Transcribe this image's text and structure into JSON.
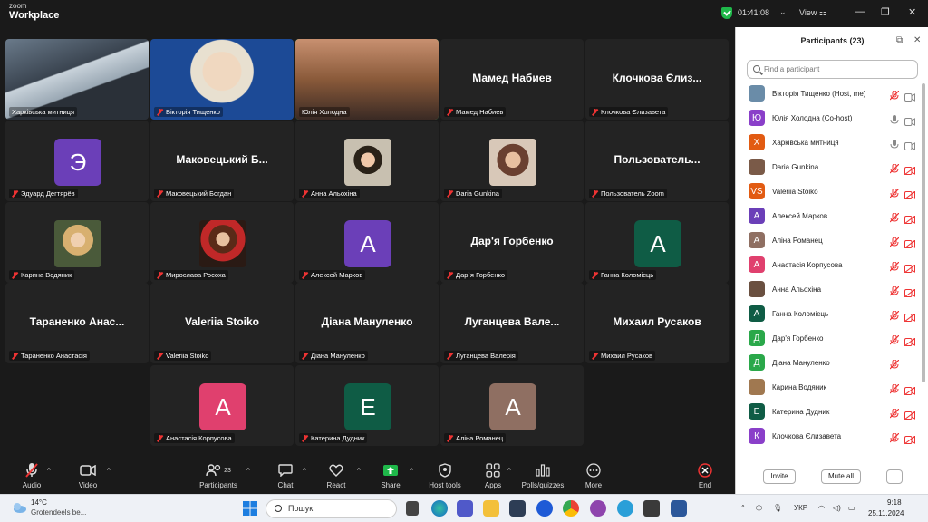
{
  "app": {
    "brand_line1": "zoom",
    "brand_line2": "Workplace",
    "timer": "01:41:08",
    "view_label": "View"
  },
  "tiles": [
    {
      "label": "Харківська митниця",
      "kind": "video",
      "muted": false
    },
    {
      "label": "Вікторія Тищенко",
      "kind": "video",
      "muted": true
    },
    {
      "label": "Юлія Холодна",
      "kind": "video",
      "muted": false,
      "active": true
    },
    {
      "name": "Мамед Набиев",
      "label": "Мамед Набиев",
      "kind": "name",
      "muted": true
    },
    {
      "name": "Клочкова Єлиз...",
      "label": "Клочкова Єлизавета",
      "kind": "name",
      "muted": true
    },
    {
      "avatar": "Э",
      "color": "#6b3fb8",
      "label": "Эдуард Дегтярёв",
      "kind": "avatar",
      "muted": true
    },
    {
      "name": "Маковецький Б...",
      "label": "Маковецький Богдан",
      "kind": "name",
      "muted": true
    },
    {
      "label": "Анна Альохіна",
      "kind": "photo",
      "muted": true
    },
    {
      "label": "Daria Gunkina",
      "kind": "photo",
      "muted": true
    },
    {
      "name": "Пользователь...",
      "label": "Пользователь Zoom",
      "kind": "name",
      "muted": true
    },
    {
      "label": "Карина Водяник",
      "kind": "photo",
      "muted": true
    },
    {
      "label": "Мирослава Росоха",
      "kind": "photo",
      "muted": true
    },
    {
      "avatar": "A",
      "color": "#6b3fb8",
      "label": "Алексей Марков",
      "kind": "avatar",
      "muted": true
    },
    {
      "name": "Дар'я Горбенко",
      "label": "Дар`я Горбенко",
      "kind": "name",
      "muted": true
    },
    {
      "avatar": "A",
      "color": "#0f5c45",
      "label": "Ганна Коломієць",
      "kind": "avatar",
      "muted": true
    },
    {
      "name": "Тараненко Анас...",
      "label": "Тараненко Анастасія",
      "kind": "name",
      "muted": true
    },
    {
      "name": "Valeriia Stoiko",
      "label": "Valeriia Stoiko",
      "kind": "name",
      "muted": true
    },
    {
      "name": "Діана Мануленко",
      "label": "Діана Мануленко",
      "kind": "name",
      "muted": true
    },
    {
      "name": "Луганцева Вале...",
      "label": "Луганцева Валерія",
      "kind": "name",
      "muted": true
    },
    {
      "name": "Михаил Русаков",
      "label": "Михаил Русаков",
      "kind": "name",
      "muted": true
    },
    {
      "avatar": "A",
      "color": "#e0406e",
      "label": "Анастасія Корпусова",
      "kind": "avatar",
      "muted": true
    },
    {
      "avatar": "E",
      "color": "#0f5c45",
      "label": "Катерина Дудник",
      "kind": "avatar",
      "muted": true
    },
    {
      "avatar": "A",
      "color": "#8f6f62",
      "label": "Аліна Романец",
      "kind": "avatar",
      "muted": true
    }
  ],
  "toolbar": {
    "audio": "Audio",
    "video": "Video",
    "participants": "Participants",
    "participants_count": "23",
    "chat": "Chat",
    "react": "React",
    "share": "Share",
    "host_tools": "Host tools",
    "apps": "Apps",
    "polls": "Polls/quizzes",
    "more": "More",
    "end": "End"
  },
  "panel": {
    "title": "Participants (23)",
    "search_placeholder": "Find a participant",
    "invite": "Invite",
    "mute_all": "Mute all",
    "more": "...",
    "participants": [
      {
        "name": "Вікторія Тищенко (Host, me)",
        "initial": "",
        "color": "#6a8ca8",
        "mic": "off",
        "video": "on"
      },
      {
        "name": "Юлія Холодна (Co-host)",
        "initial": "Ю",
        "color": "#8a3fc9",
        "mic": "on",
        "video": "on"
      },
      {
        "name": "Харківська митниця",
        "initial": "Х",
        "color": "#e25b12",
        "mic": "on",
        "video": "on"
      },
      {
        "name": "Daria Gunkina",
        "initial": "",
        "color": "#7a5a48",
        "mic": "off",
        "video": "off"
      },
      {
        "name": "Valeriia Stoiko",
        "initial": "VS",
        "color": "#e25b12",
        "mic": "off",
        "video": "off"
      },
      {
        "name": "Алексей Марков",
        "initial": "A",
        "color": "#6b3fb8",
        "mic": "off",
        "video": "off"
      },
      {
        "name": "Аліна Романец",
        "initial": "A",
        "color": "#8f6f62",
        "mic": "off",
        "video": "off"
      },
      {
        "name": "Анастасія Корпусова",
        "initial": "A",
        "color": "#e0406e",
        "mic": "off",
        "video": "off"
      },
      {
        "name": "Анна Альохіна",
        "initial": "",
        "color": "#6a5040",
        "mic": "off",
        "video": "off"
      },
      {
        "name": "Ганна Коломієць",
        "initial": "A",
        "color": "#0f5c45",
        "mic": "off",
        "video": "off"
      },
      {
        "name": "Дар'я Горбенко",
        "initial": "Д",
        "color": "#2aa84a",
        "mic": "off",
        "video": "off"
      },
      {
        "name": "Діана Мануленко",
        "initial": "Д",
        "color": "#2aa84a",
        "mic": "off",
        "video": "none"
      },
      {
        "name": "Карина Водяник",
        "initial": "",
        "color": "#a07850",
        "mic": "off",
        "video": "off"
      },
      {
        "name": "Катерина Дудник",
        "initial": "E",
        "color": "#0f5c45",
        "mic": "off",
        "video": "off"
      },
      {
        "name": "Клочкова Єлизавета",
        "initial": "К",
        "color": "#8a3fc9",
        "mic": "off",
        "video": "off"
      }
    ]
  },
  "taskbar": {
    "weather_temp": "14°C",
    "weather_desc": "Grotendeels be...",
    "search": "Пошук",
    "lang": "УКР",
    "time": "9:18",
    "date": "25.11.2024"
  }
}
